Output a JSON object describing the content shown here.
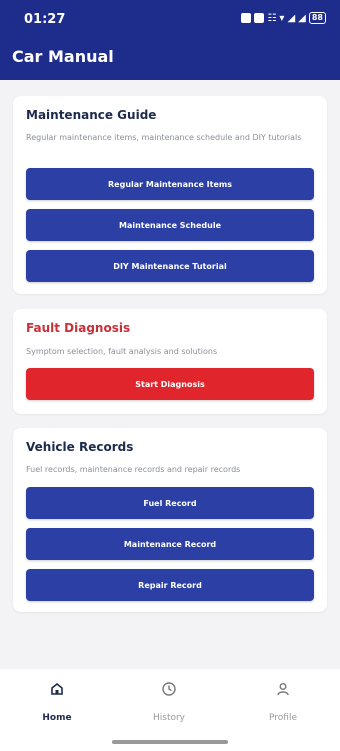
{
  "status": {
    "time": "01:27",
    "battery": "88"
  },
  "app": {
    "title": "Car Manual"
  },
  "maintenance": {
    "title": "Maintenance Guide",
    "description": "Regular maintenance items, maintenance schedule and DIY tutorials",
    "buttons": [
      "Regular Maintenance Items",
      "Maintenance Schedule",
      "DIY Maintenance Tutorial"
    ]
  },
  "fault": {
    "title": "Fault Diagnosis",
    "description": "Symptom selection, fault analysis and solutions",
    "button": "Start Diagnosis"
  },
  "records": {
    "title": "Vehicle Records",
    "description": "Fuel records, maintenance records and repair records",
    "buttons": [
      "Fuel Record",
      "Maintenance Record",
      "Repair Record"
    ]
  },
  "nav": {
    "items": [
      "Home",
      "History",
      "Profile"
    ]
  },
  "colors": {
    "primary": "#2b3fa5",
    "header": "#1e2d8c",
    "danger": "#e0252c"
  }
}
